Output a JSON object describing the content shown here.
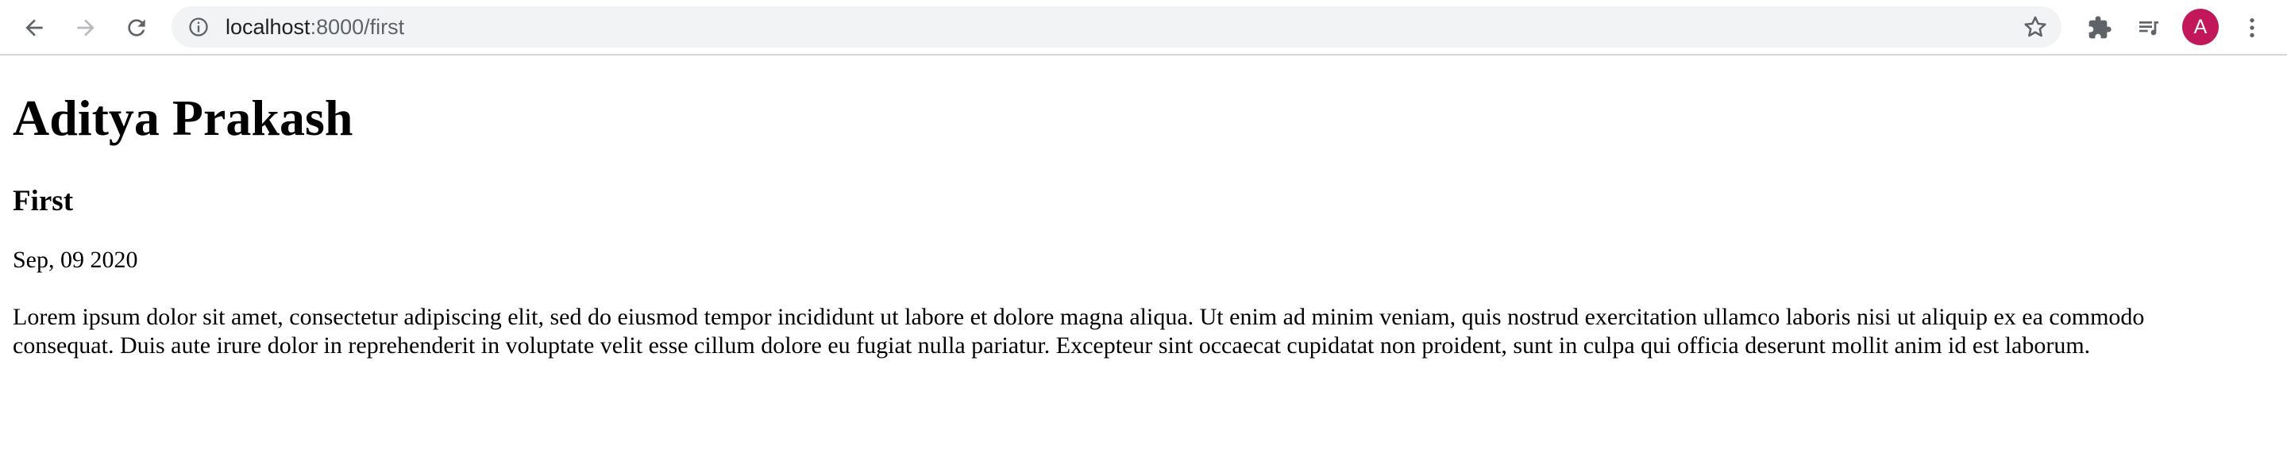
{
  "browser": {
    "url_host": "localhost",
    "url_path": ":8000/first",
    "profile_initial": "A",
    "icons": {
      "back": "arrow-left-icon",
      "forward": "arrow-right-icon",
      "reload": "reload-icon",
      "site_info": "info-icon",
      "bookmark": "star-icon",
      "extensions": "puzzle-icon",
      "media": "media-queue-icon",
      "menu": "kebab-menu-icon"
    },
    "colors": {
      "omnibox_bg": "#f1f3f4",
      "avatar_bg": "#c2185b"
    }
  },
  "page": {
    "site_title": "Aditya Prakash",
    "post_title": "First",
    "post_date": "Sep, 09 2020",
    "post_body": "Lorem ipsum dolor sit amet, consectetur adipiscing elit, sed do eiusmod tempor incididunt ut labore et dolore magna aliqua. Ut enim ad minim veniam, quis nostrud exercitation ullamco laboris nisi ut aliquip ex ea commodo consequat. Duis aute irure dolor in reprehenderit in voluptate velit esse cillum dolore eu fugiat nulla pariatur. Excepteur sint occaecat cupidatat non proident, sunt in culpa qui officia deserunt mollit anim id est laborum."
  }
}
